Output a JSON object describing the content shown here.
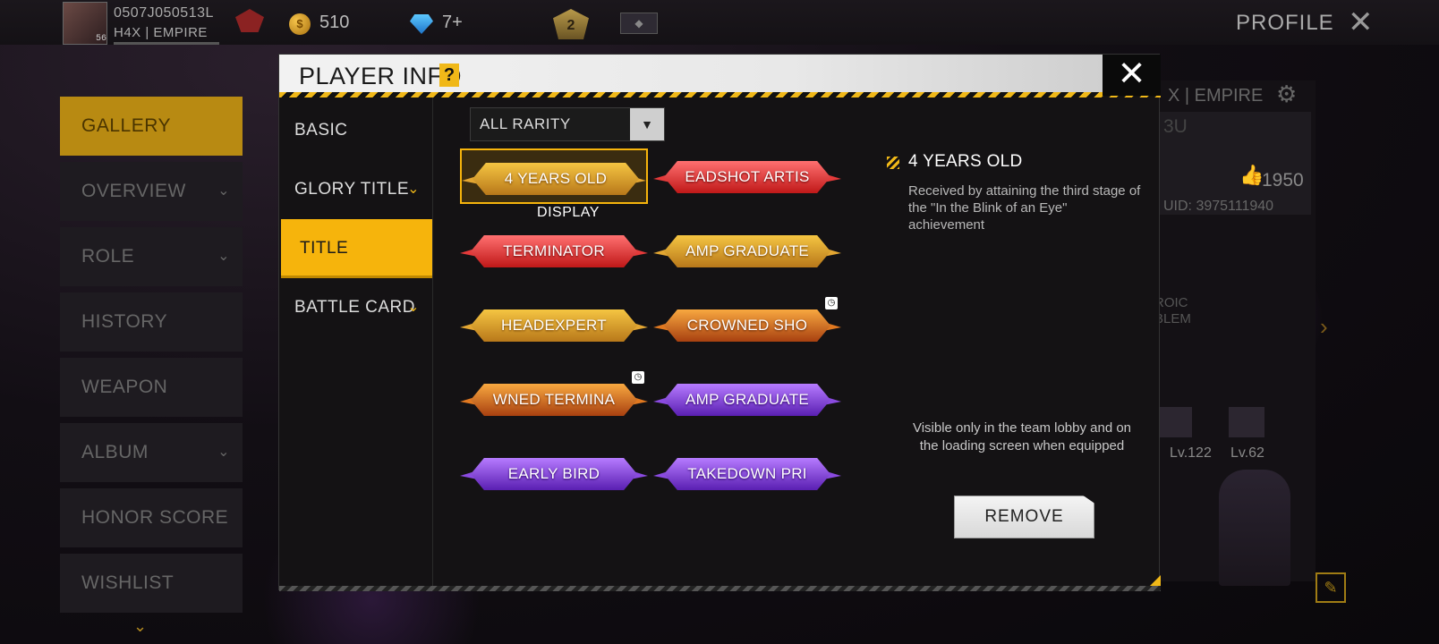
{
  "topbar": {
    "player_name": "0507J050513L",
    "guild": "H4X | EMPIRE",
    "avatar_level": "56",
    "coins": "510",
    "diamonds": "7+",
    "rank_number": "2",
    "page_title": "PROFILE"
  },
  "menu": {
    "items": [
      {
        "label": "GALLERY",
        "active": true,
        "chevron": false
      },
      {
        "label": "OVERVIEW",
        "active": false,
        "chevron": true
      },
      {
        "label": "ROLE",
        "active": false,
        "chevron": true
      },
      {
        "label": "HISTORY",
        "active": false,
        "chevron": false
      },
      {
        "label": "WEAPON",
        "active": false,
        "chevron": false
      },
      {
        "label": "ALBUM",
        "active": false,
        "chevron": true
      },
      {
        "label": "HONOR SCORE",
        "active": false,
        "chevron": false
      },
      {
        "label": "WISHLIST",
        "active": false,
        "chevron": false
      }
    ]
  },
  "right_panel": {
    "guild": "X | EMPIRE",
    "card_code": "3U",
    "likes": "1950",
    "uid": "UID: 3975111940",
    "emblem_label": "ROIC\nBLEM",
    "level_1": "Lv.122",
    "level_2": "Lv.62"
  },
  "modal": {
    "title": "PLAYER INFO",
    "help": "?",
    "tabs": [
      {
        "label": "BASIC",
        "active": false,
        "chevron": false
      },
      {
        "label": "GLORY TITLE",
        "active": false,
        "chevron": true
      },
      {
        "label": "TITLE",
        "active": true,
        "chevron": false
      },
      {
        "label": "BATTLE CARD",
        "active": false,
        "chevron": true
      }
    ],
    "filter": "ALL RARITY",
    "display_tag": "DISPLAY",
    "titles": [
      {
        "label": "4 YEARS OLD",
        "style": "gold",
        "selected": true,
        "timed": false
      },
      {
        "label": "EADSHOT ARTIS",
        "style": "red",
        "selected": false,
        "timed": false
      },
      {
        "label": "TERMINATOR",
        "style": "red",
        "selected": false,
        "timed": false
      },
      {
        "label": "AMP GRADUATE",
        "style": "gold",
        "selected": false,
        "timed": false
      },
      {
        "label": "HEADEXPERT",
        "style": "gold",
        "selected": false,
        "timed": false
      },
      {
        "label": "CROWNED SHO",
        "style": "fire",
        "selected": false,
        "timed": true
      },
      {
        "label": "WNED TERMINA",
        "style": "fire",
        "selected": false,
        "timed": true
      },
      {
        "label": "AMP GRADUATE",
        "style": "purple",
        "selected": false,
        "timed": false
      },
      {
        "label": "EARLY BIRD",
        "style": "purple",
        "selected": false,
        "timed": false
      },
      {
        "label": "TAKEDOWN PRI",
        "style": "purple",
        "selected": false,
        "timed": false
      }
    ],
    "detail": {
      "title": "4 YEARS OLD",
      "description": "Received by attaining the third stage of the \"In the Blink of an Eye\" achievement",
      "visibility": "Visible only in the team lobby and on the loading screen when equipped",
      "remove_label": "REMOVE"
    }
  }
}
